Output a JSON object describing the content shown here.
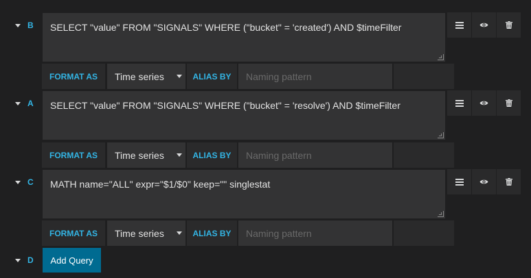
{
  "queries": [
    {
      "ref": "B",
      "text": "SELECT \"value\" FROM \"SIGNALS\" WHERE (\"bucket\" = 'created') AND $timeFilter",
      "format_label": "FORMAT AS",
      "format_value": "Time series",
      "alias_label": "ALIAS BY",
      "alias_placeholder": "Naming pattern"
    },
    {
      "ref": "A",
      "text": "SELECT \"value\" FROM \"SIGNALS\" WHERE (\"bucket\" = 'resolve') AND $timeFilter",
      "format_label": "FORMAT AS",
      "format_value": "Time series",
      "alias_label": "ALIAS BY",
      "alias_placeholder": "Naming pattern"
    },
    {
      "ref": "C",
      "text": "MATH name=\"ALL\" expr=\"$1/$0\" keep=\"\" singlestat",
      "format_label": "FORMAT AS",
      "format_value": "Time series",
      "alias_label": "ALIAS BY",
      "alias_placeholder": "Naming pattern"
    }
  ],
  "add": {
    "ref": "D",
    "label": "Add Query"
  },
  "icons": {
    "menu": "hamburger-menu-icon",
    "eye": "eye-icon",
    "trash": "trash-icon",
    "caret": "caret-down-icon"
  },
  "colors": {
    "background": "#1f1f20",
    "accent": "#33b5e5",
    "button": "#006b91",
    "field": "#333334",
    "panel": "#2a2a2b"
  }
}
